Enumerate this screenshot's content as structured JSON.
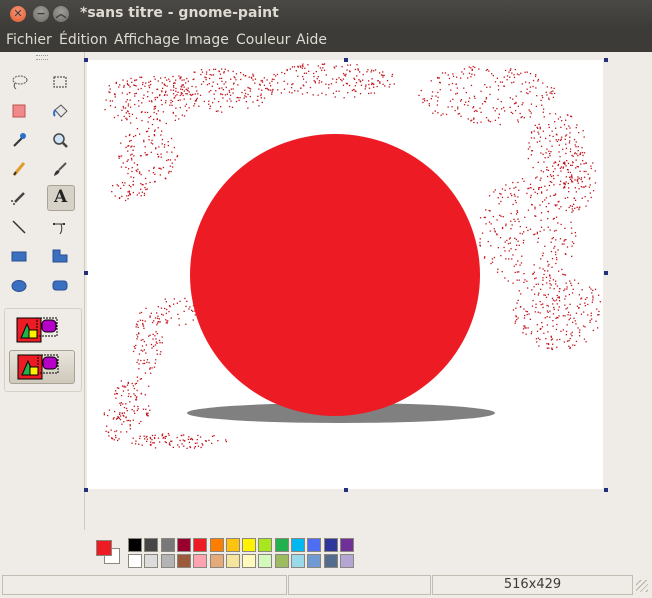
{
  "window": {
    "title": "*sans titre - gnome-paint"
  },
  "menubar": {
    "items": [
      "Fichier",
      "Édition",
      "Affichage",
      "Image",
      "Couleur",
      "Aide"
    ]
  },
  "tools": [
    {
      "name": "lasso-select-icon"
    },
    {
      "name": "rect-select-icon"
    },
    {
      "name": "eraser-icon"
    },
    {
      "name": "fill-bucket-icon"
    },
    {
      "name": "color-picker-icon"
    },
    {
      "name": "magnifier-icon"
    },
    {
      "name": "pencil-icon"
    },
    {
      "name": "brush-icon"
    },
    {
      "name": "airbrush-icon"
    },
    {
      "name": "text-tool-icon",
      "glyph": "A"
    },
    {
      "name": "line-tool-icon"
    },
    {
      "name": "curve-tool-icon"
    },
    {
      "name": "rectangle-tool-icon"
    },
    {
      "name": "polygon-tool-icon"
    },
    {
      "name": "ellipse-tool-icon"
    },
    {
      "name": "rounded-rect-tool-icon"
    }
  ],
  "palette": {
    "primary": "#ed1c24",
    "secondary": "#ffffff",
    "row1": [
      "#000000",
      "#464646",
      "#787878",
      "#990030",
      "#ed1c24",
      "#ff7e00",
      "#ffc20e",
      "#fff200",
      "#a8e61d",
      "#22b14c",
      "#00b7ef",
      "#4d6df3",
      "#2f3699",
      "#6f3198"
    ],
    "row2": [
      "#ffffff",
      "#dcdcdc",
      "#b4b4b4",
      "#9c5a3c",
      "#ffa3b1",
      "#e5aa7a",
      "#f5e49c",
      "#fff9bd",
      "#d3f9bc",
      "#9dbb61",
      "#99d9ea",
      "#709ad1",
      "#546d8e",
      "#b5a5d5"
    ]
  },
  "canvas": {
    "shadow_color": "#808080",
    "spray_color": "#c0141c"
  },
  "status": {
    "left": "",
    "middle": "",
    "dimensions": "516x429"
  }
}
